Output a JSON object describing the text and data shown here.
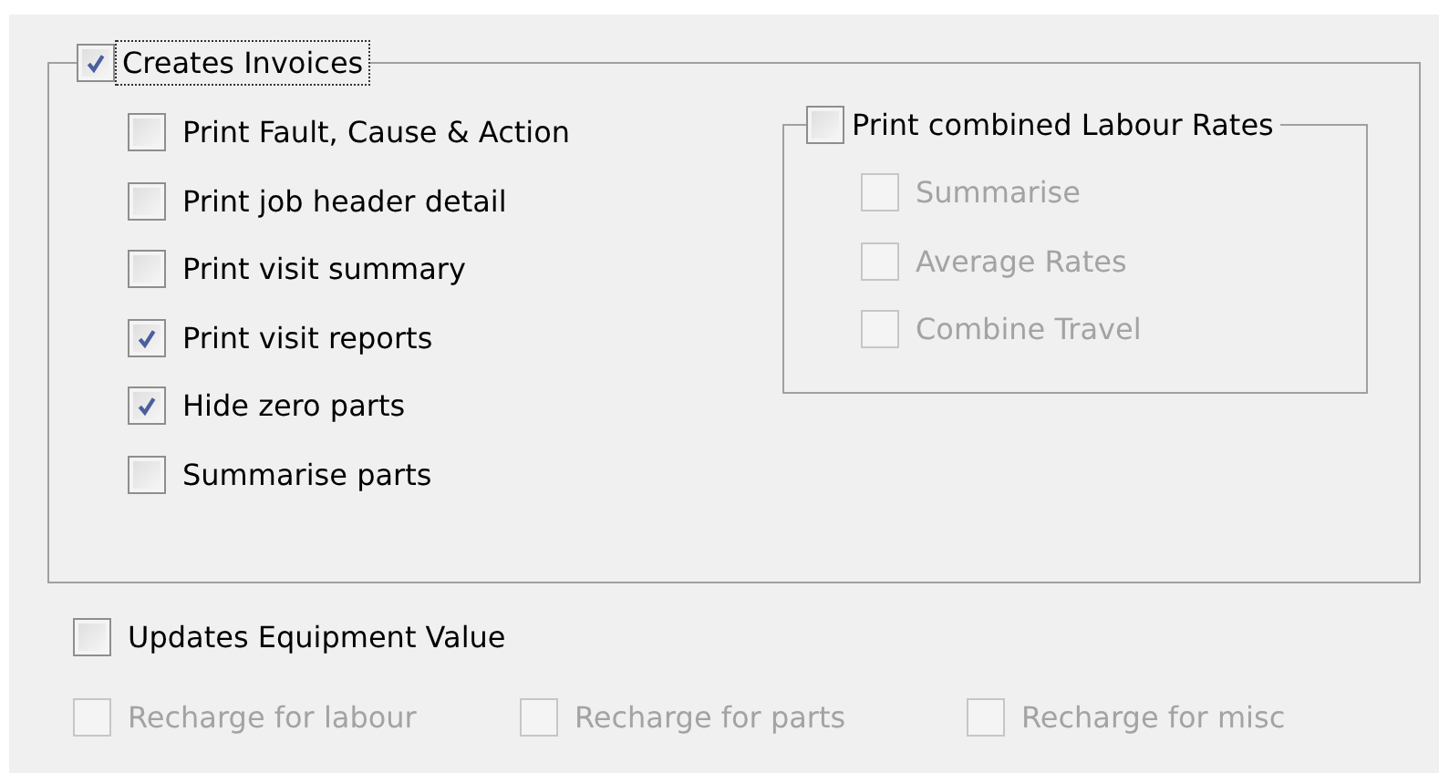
{
  "creates_invoices": {
    "label": "Creates Invoices",
    "checked": true,
    "focused": true,
    "options": [
      {
        "label": "Print Fault, Cause & Action",
        "checked": false,
        "disabled": false
      },
      {
        "label": "Print job header detail",
        "checked": false,
        "disabled": false
      },
      {
        "label": "Print visit summary",
        "checked": false,
        "disabled": false
      },
      {
        "label": "Print visit reports",
        "checked": true,
        "disabled": false
      },
      {
        "label": "Hide zero parts",
        "checked": true,
        "disabled": false
      },
      {
        "label": "Summarise parts",
        "checked": false,
        "disabled": false
      }
    ],
    "labour_rates": {
      "label": "Print combined Labour Rates",
      "checked": false,
      "options": [
        {
          "label": "Summarise",
          "checked": false,
          "disabled": true
        },
        {
          "label": "Average Rates",
          "checked": false,
          "disabled": true
        },
        {
          "label": "Combine Travel",
          "checked": false,
          "disabled": true
        }
      ]
    }
  },
  "updates_equipment_value": {
    "label": "Updates Equipment Value",
    "checked": false
  },
  "recharge_options": [
    {
      "label": "Recharge for labour",
      "checked": false,
      "disabled": true
    },
    {
      "label": "Recharge for parts",
      "checked": false,
      "disabled": true
    },
    {
      "label": "Recharge for misc",
      "checked": false,
      "disabled": true
    }
  ]
}
